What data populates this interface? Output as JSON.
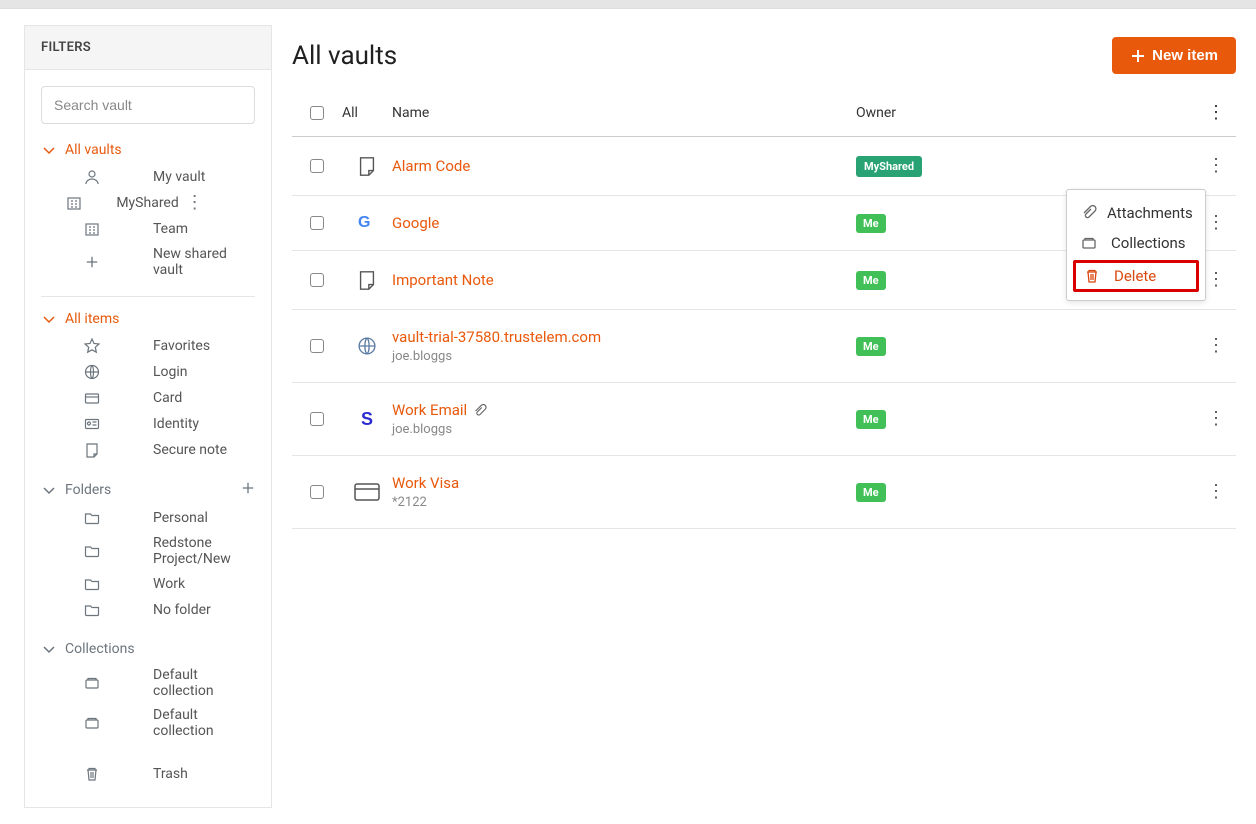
{
  "filters": {
    "heading": "FILTERS",
    "search_placeholder": "Search vault",
    "vaults_label": "All vaults",
    "vaults": [
      {
        "label": "My vault"
      },
      {
        "label": "MyShared"
      },
      {
        "label": "Team"
      }
    ],
    "new_shared_label": "New shared vault",
    "items_label": "All items",
    "items": [
      {
        "label": "Favorites"
      },
      {
        "label": "Login"
      },
      {
        "label": "Card"
      },
      {
        "label": "Identity"
      },
      {
        "label": "Secure note"
      }
    ],
    "folders_label": "Folders",
    "folders": [
      {
        "label": "Personal"
      },
      {
        "label": "Redstone Project/New"
      },
      {
        "label": "Work"
      },
      {
        "label": "No folder"
      }
    ],
    "collections_label": "Collections",
    "collections": [
      {
        "label": "Default collection"
      },
      {
        "label": "Default collection"
      }
    ],
    "trash_label": "Trash"
  },
  "main": {
    "title": "All vaults",
    "new_item_label": "New item",
    "columns": {
      "all": "All",
      "name": "Name",
      "owner": "Owner"
    },
    "rows": [
      {
        "name": "Alarm Code",
        "sub": "",
        "owner_badge": "MyShared",
        "icon": "note",
        "attach": false
      },
      {
        "name": "Google",
        "sub": "",
        "owner_badge": "Me",
        "icon": "google",
        "attach": false
      },
      {
        "name": "Important Note",
        "sub": "",
        "owner_badge": "Me",
        "icon": "note",
        "attach": false
      },
      {
        "name": "vault-trial-37580.trustelem.com",
        "sub": "joe.bloggs",
        "owner_badge": "Me",
        "icon": "globe",
        "attach": false
      },
      {
        "name": "Work Email",
        "sub": "joe.bloggs",
        "owner_badge": "Me",
        "icon": "s",
        "attach": true
      },
      {
        "name": "Work Visa",
        "sub": "*2122",
        "owner_badge": "Me",
        "icon": "card",
        "attach": false
      }
    ]
  },
  "context_menu": {
    "attachments": "Attachments",
    "collections": "Collections",
    "delete": "Delete"
  }
}
